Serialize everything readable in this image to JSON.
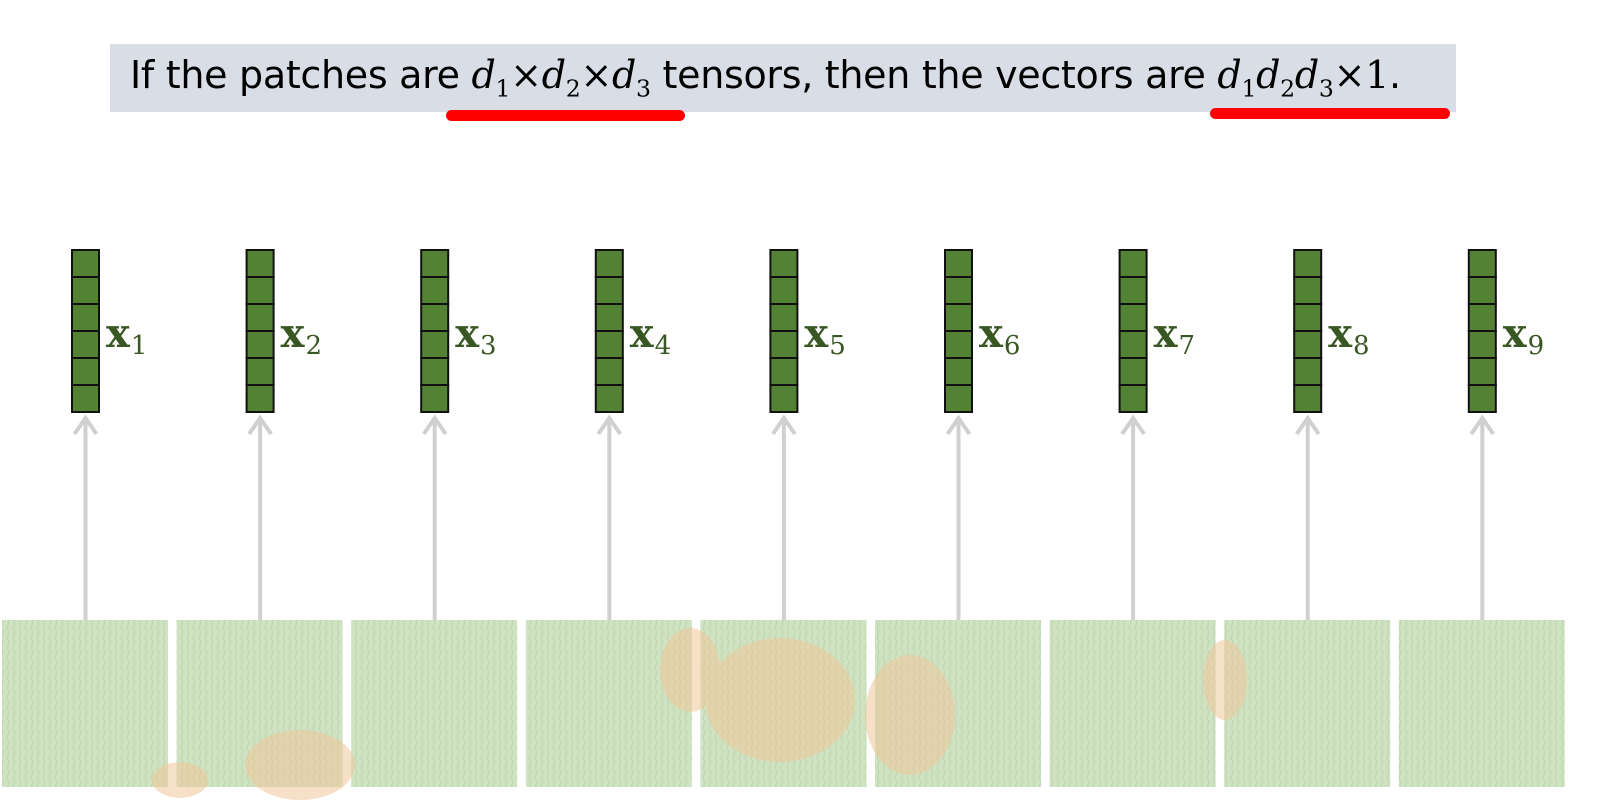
{
  "header": {
    "part1": "If the patches are ",
    "tensor_dims": [
      {
        "base": "d",
        "sub": "1"
      },
      {
        "op": "×"
      },
      {
        "base": "d",
        "sub": "2"
      },
      {
        "op": "×"
      },
      {
        "base": "d",
        "sub": "3"
      }
    ],
    "part2": " tensors, then the vectors are ",
    "vector_dims": [
      {
        "base": "d",
        "sub": "1"
      },
      {
        "base": "d",
        "sub": "2"
      },
      {
        "base": "d",
        "sub": "3"
      },
      {
        "op": "×"
      },
      {
        "op": "1"
      }
    ],
    "part3": "."
  },
  "vectors": [
    {
      "base": "x",
      "sub": "1"
    },
    {
      "base": "x",
      "sub": "2"
    },
    {
      "base": "x",
      "sub": "3"
    },
    {
      "base": "x",
      "sub": "4"
    },
    {
      "base": "x",
      "sub": "5"
    },
    {
      "base": "x",
      "sub": "6"
    },
    {
      "base": "x",
      "sub": "7"
    },
    {
      "base": "x",
      "sub": "8"
    },
    {
      "base": "x",
      "sub": "9"
    }
  ],
  "vector_cells": 6,
  "colors": {
    "vector_fill": "#548235",
    "vector_label": "#385723",
    "arrow": "#d0d0d0",
    "underline": "#ff0000",
    "header_bg": "#d9dde5",
    "patch_grass": "#cfe3c3",
    "patch_dog": "#f0c79a"
  }
}
